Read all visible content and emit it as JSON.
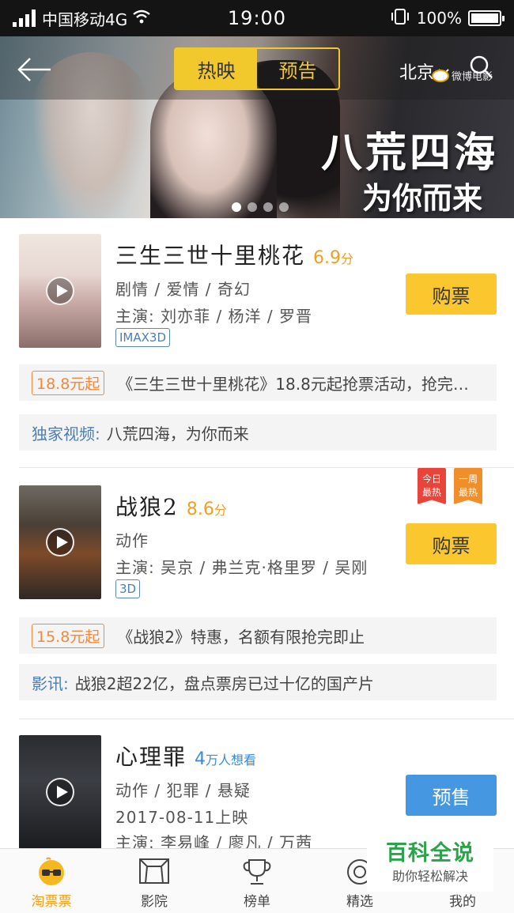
{
  "status_bar": {
    "carrier": "中国移动4G",
    "time": "19:00",
    "battery": "100%"
  },
  "header": {
    "tabs": [
      {
        "label": "热映",
        "active": true
      },
      {
        "label": "预告",
        "active": false
      }
    ],
    "city": "北京",
    "weibo_label": "微博电影"
  },
  "banner": {
    "slogan_line1": "八荒四海",
    "slogan_line2": "为你而来",
    "page_count": 4,
    "current_page": 1
  },
  "movies": [
    {
      "title": "三生三世十里桃花",
      "score": "6.9",
      "score_unit": "分",
      "genres": "剧情 / 爱情 / 奇幻",
      "cast": "主演: 刘亦菲 / 杨洋 / 罗晋",
      "format": "IMAX3D",
      "button": "购票",
      "promo_price": "18.8元起",
      "promo_text": "《三生三世十里桃花》18.8元起抢票活动，抢完…",
      "news_label": "独家视频:",
      "news_text": "八荒四海，为你而来"
    },
    {
      "title": "战狼2",
      "score": "8.6",
      "score_unit": "分",
      "genres": "动作",
      "cast": "主演: 吴京 / 弗兰克·格里罗 / 吴刚",
      "format": "3D",
      "button": "购票",
      "badges": [
        {
          "line1": "今日",
          "line2": "最热"
        },
        {
          "line1": "一周",
          "line2": "最热"
        }
      ],
      "promo_price": "15.8元起",
      "promo_text": "《战狼2》特惠，名额有限抢完即止",
      "news_label": "影讯:",
      "news_text": "战狼2超22亿，盘点票房已过十亿的国产片"
    },
    {
      "title": "心理罪",
      "score": "4",
      "score_unit": "万人想看",
      "genres": "动作 / 犯罪 / 悬疑",
      "release": "2017-08-11上映",
      "cast": "主演: 李易峰 / 廖凡 / 万茜",
      "button": "预售"
    }
  ],
  "bottom_nav": [
    {
      "label": "淘票票",
      "icon": "taopiaopiao-glasses-icon",
      "active": true
    },
    {
      "label": "影院",
      "icon": "cinema-screen-icon",
      "active": false
    },
    {
      "label": "榜单",
      "icon": "trophy-icon",
      "active": false
    },
    {
      "label": "精选",
      "icon": "discover-icon",
      "active": false
    },
    {
      "label": "我的",
      "icon": "profile-icon",
      "active": false
    }
  ],
  "watermark": {
    "logo": "百科全说",
    "tagline": "助你轻松解决"
  }
}
